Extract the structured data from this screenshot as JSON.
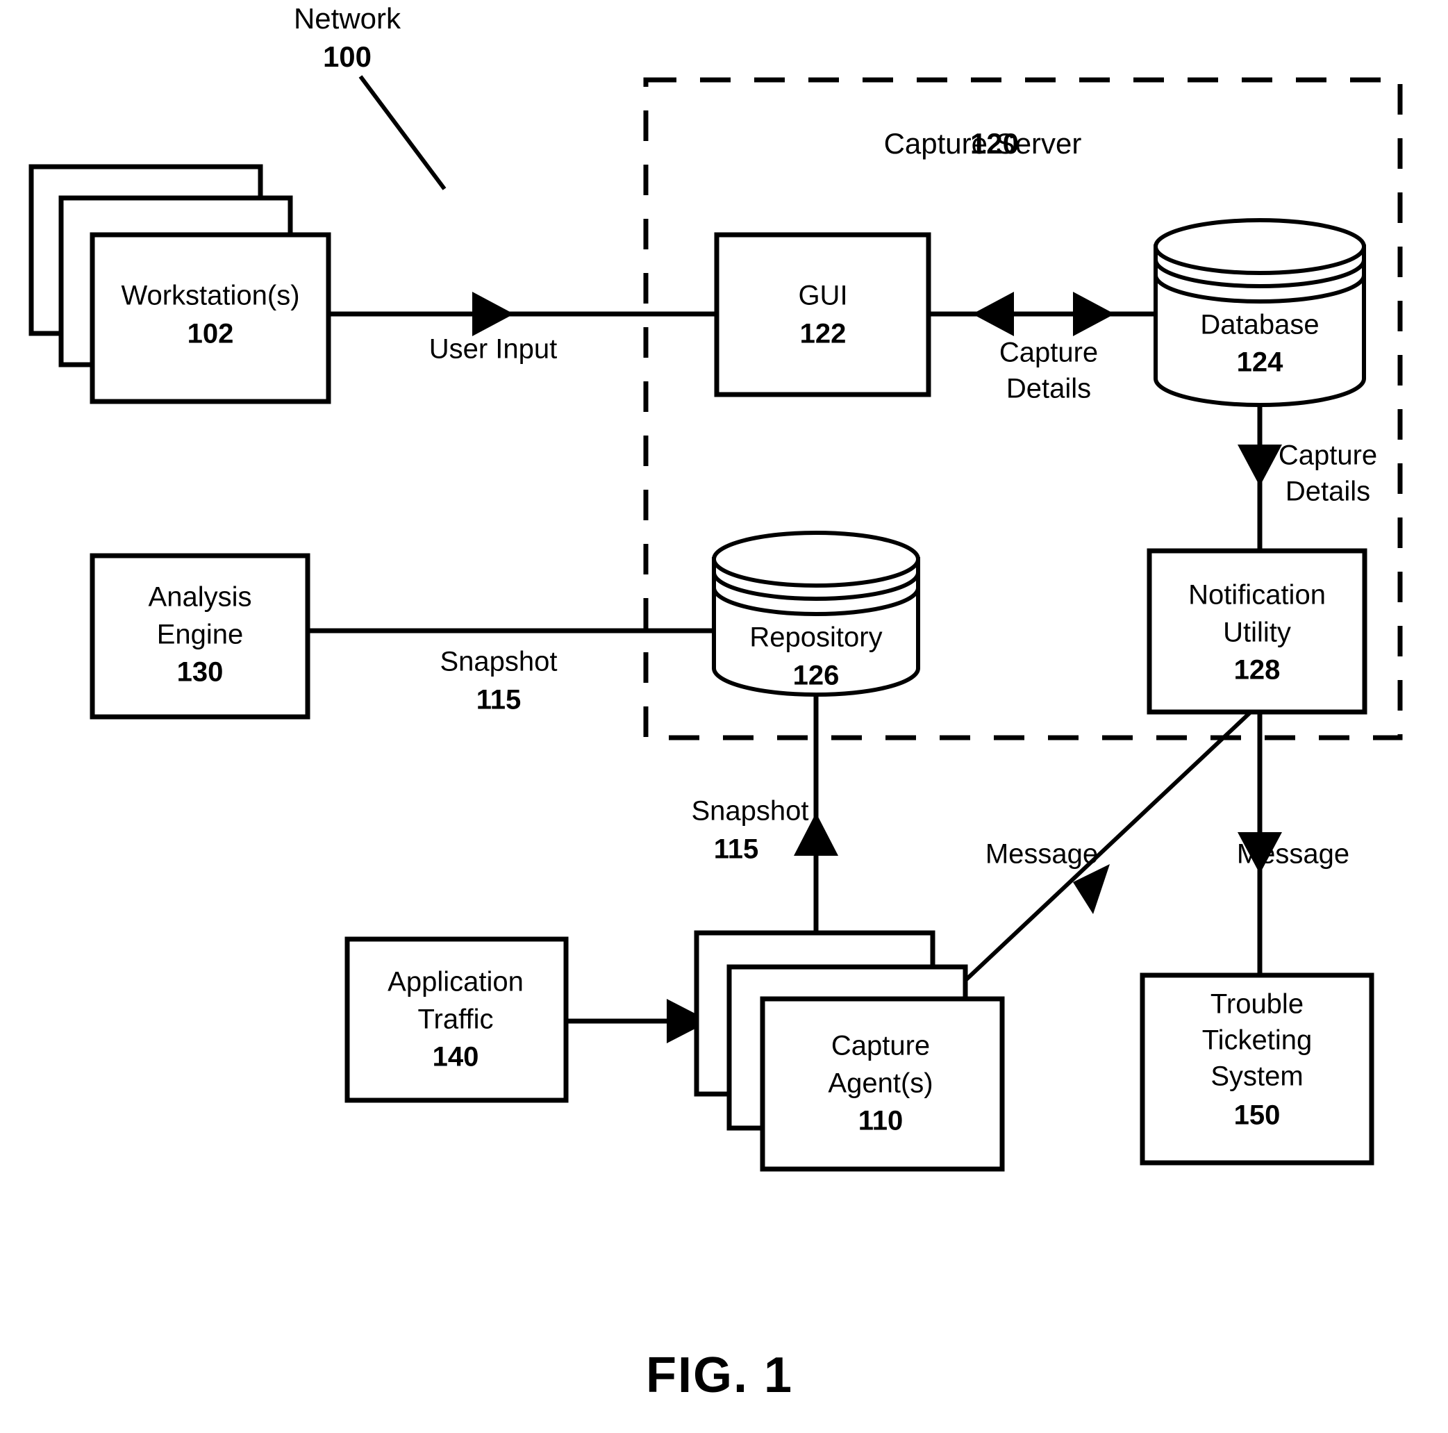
{
  "figure": {
    "caption": "FIG. 1",
    "network_label": "Network",
    "network_ref": "100",
    "boundary_title": "Capture Server",
    "boundary_ref": "120"
  },
  "nodes": {
    "workstations": {
      "line1": "Workstation(s)",
      "ref": "102",
      "shape": "stacked-box"
    },
    "gui": {
      "line1": "GUI",
      "ref": "122",
      "shape": "box"
    },
    "database": {
      "line1": "Database",
      "ref": "124",
      "shape": "cylinder"
    },
    "notification_utility": {
      "line1": "Notification",
      "line2": "Utility",
      "ref": "128",
      "shape": "box"
    },
    "repository": {
      "line1": "Repository",
      "ref": "126",
      "shape": "cylinder"
    },
    "analysis_engine": {
      "line1": "Analysis",
      "line2": "Engine",
      "ref": "130",
      "shape": "box"
    },
    "application_traffic": {
      "line1": "Application",
      "line2": "Traffic",
      "ref": "140",
      "shape": "box"
    },
    "capture_agents": {
      "line1": "Capture",
      "line2": "Agent(s)",
      "ref": "110",
      "shape": "stacked-box"
    },
    "trouble_ticketing": {
      "line1": "Trouble",
      "line2": "Ticketing",
      "line3": "System",
      "ref": "150",
      "shape": "box"
    }
  },
  "edges": {
    "user_input": {
      "label": "User Input"
    },
    "capture_details_gui_db": {
      "line1": "Capture",
      "line2": "Details"
    },
    "capture_details_db_notif": {
      "line1": "Capture",
      "line2": "Details"
    },
    "snapshot_repo_analysis": {
      "line1": "Snapshot",
      "ref": "115"
    },
    "snapshot_agent_repo": {
      "line1": "Snapshot",
      "ref": "115"
    },
    "message_notif_agent": {
      "label": "Message"
    },
    "message_notif_ticketing": {
      "label": "Message"
    }
  },
  "colors": {
    "ink": "#000000",
    "paper": "#ffffff"
  }
}
